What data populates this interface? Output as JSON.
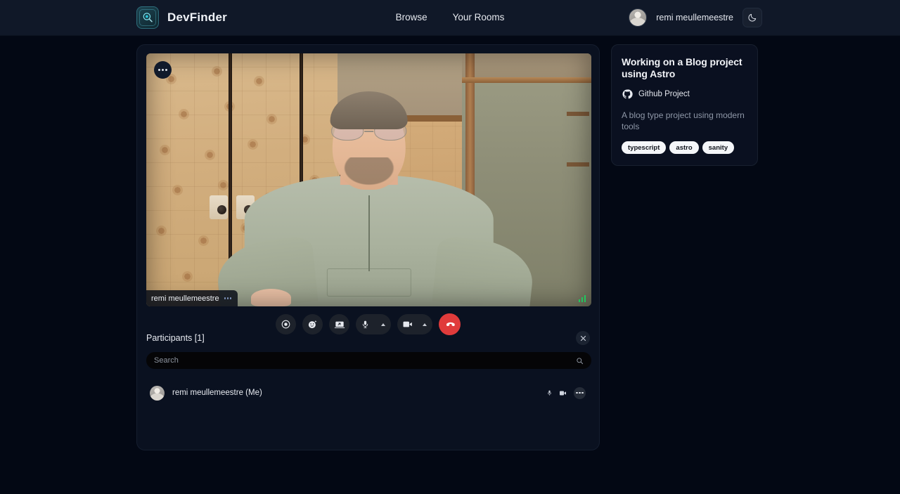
{
  "header": {
    "brand_name": "DevFinder",
    "logo_icon": "devfinder-magnifier-logo",
    "nav": [
      {
        "label": "Browse",
        "name": "nav-browse"
      },
      {
        "label": "Your Rooms",
        "name": "nav-your-rooms"
      }
    ],
    "user": {
      "name": "remi meullemeestre",
      "avatar_icon": "user-avatar"
    },
    "theme_toggle": {
      "icon": "moon-icon",
      "label": "Toggle dark mode"
    }
  },
  "room": {
    "video": {
      "menu_icon": "ellipsis-icon",
      "name_tag": "remi meullemeestre",
      "name_tag_menu_icon": "ellipsis-icon",
      "signal_icon": "signal-strength-icon"
    },
    "controls": [
      {
        "name": "record-button",
        "icon": "record-circle-icon",
        "label": "Record"
      },
      {
        "name": "reactions-button",
        "icon": "emoji-sparkle-icon",
        "label": "Reactions"
      },
      {
        "name": "screen-share-button",
        "icon": "screen-share-icon",
        "label": "Share screen"
      },
      {
        "name": "microphone-button",
        "icon": "microphone-icon",
        "label": "Microphone",
        "has_dropdown": true
      },
      {
        "name": "camera-button",
        "icon": "video-camera-icon",
        "label": "Camera",
        "has_dropdown": true
      },
      {
        "name": "end-call-button",
        "icon": "phone-hangup-icon",
        "label": "Leave call"
      }
    ],
    "participants": {
      "title": "Participants [1]",
      "close_icon": "close-icon",
      "search_placeholder": "Search",
      "search_value": "",
      "search_icon": "search-icon",
      "list": [
        {
          "name": "remi meullemeestre (Me)",
          "avatar_icon": "user-avatar",
          "mic_icon": "microphone-icon",
          "camera_icon": "video-camera-icon",
          "more_icon": "ellipsis-icon"
        }
      ]
    }
  },
  "sidebar": {
    "card": {
      "title": "Working on a Blog project using Astro",
      "repo_icon": "github-icon",
      "repo_label": "Github Project",
      "description": "A blog type project using modern tools",
      "tags": [
        "typescript",
        "astro",
        "sanity"
      ]
    }
  },
  "colors": {
    "page_background": "#030814",
    "header_background": "#101828",
    "panel_background": "#0a1120",
    "card_background": "#0a1020",
    "accent_danger": "#e03b3b",
    "signal_green": "#22c55e",
    "tag_background": "#f4f6f9",
    "muted_text": "#8e97a7"
  }
}
